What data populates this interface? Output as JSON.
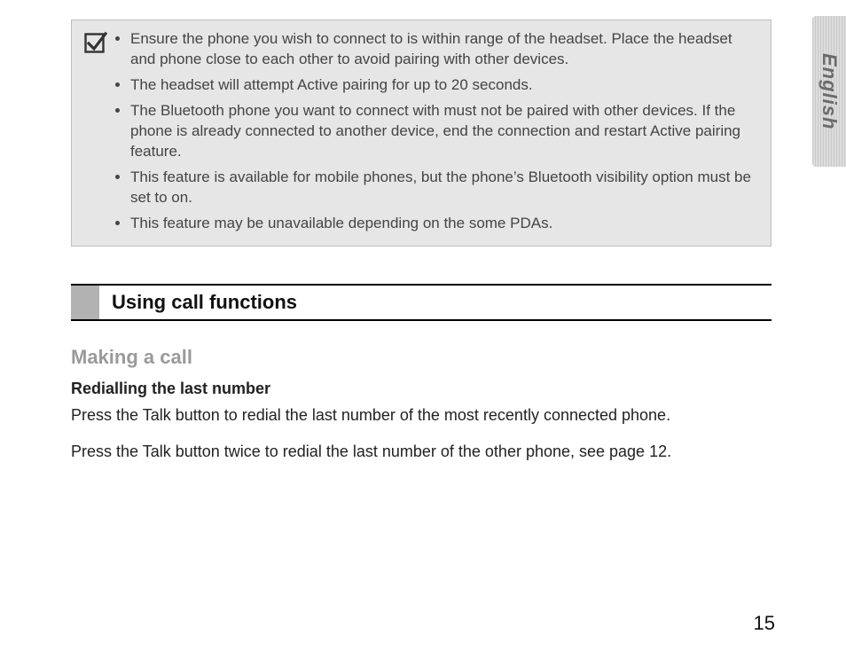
{
  "side_tab": "English",
  "info_box": {
    "icon": "checkbox-icon",
    "items": [
      "Ensure the phone you wish to connect to is within range of the headset. Place the headset and phone close to each other to avoid pairing with other devices.",
      "The headset will attempt Active pairing for up to 20 seconds.",
      "The Bluetooth phone you want to connect with must not be paired with other devices. If the phone is already connected to another device, end the connection and restart Active pairing feature.",
      "This feature is available for mobile phones, but the phone’s Bluetooth visibility option must be set to on.",
      "This feature may be unavailable depending on the some PDAs."
    ]
  },
  "section_title": "Using call functions",
  "subsection_title": "Making a call",
  "subsubsection_title": "Redialling the last number",
  "paragraphs": [
    "Press the Talk button to redial the last number of the most recently connected phone.",
    "Press the Talk button twice to redial the last number of the other phone, see page 12."
  ],
  "page_number": "15"
}
